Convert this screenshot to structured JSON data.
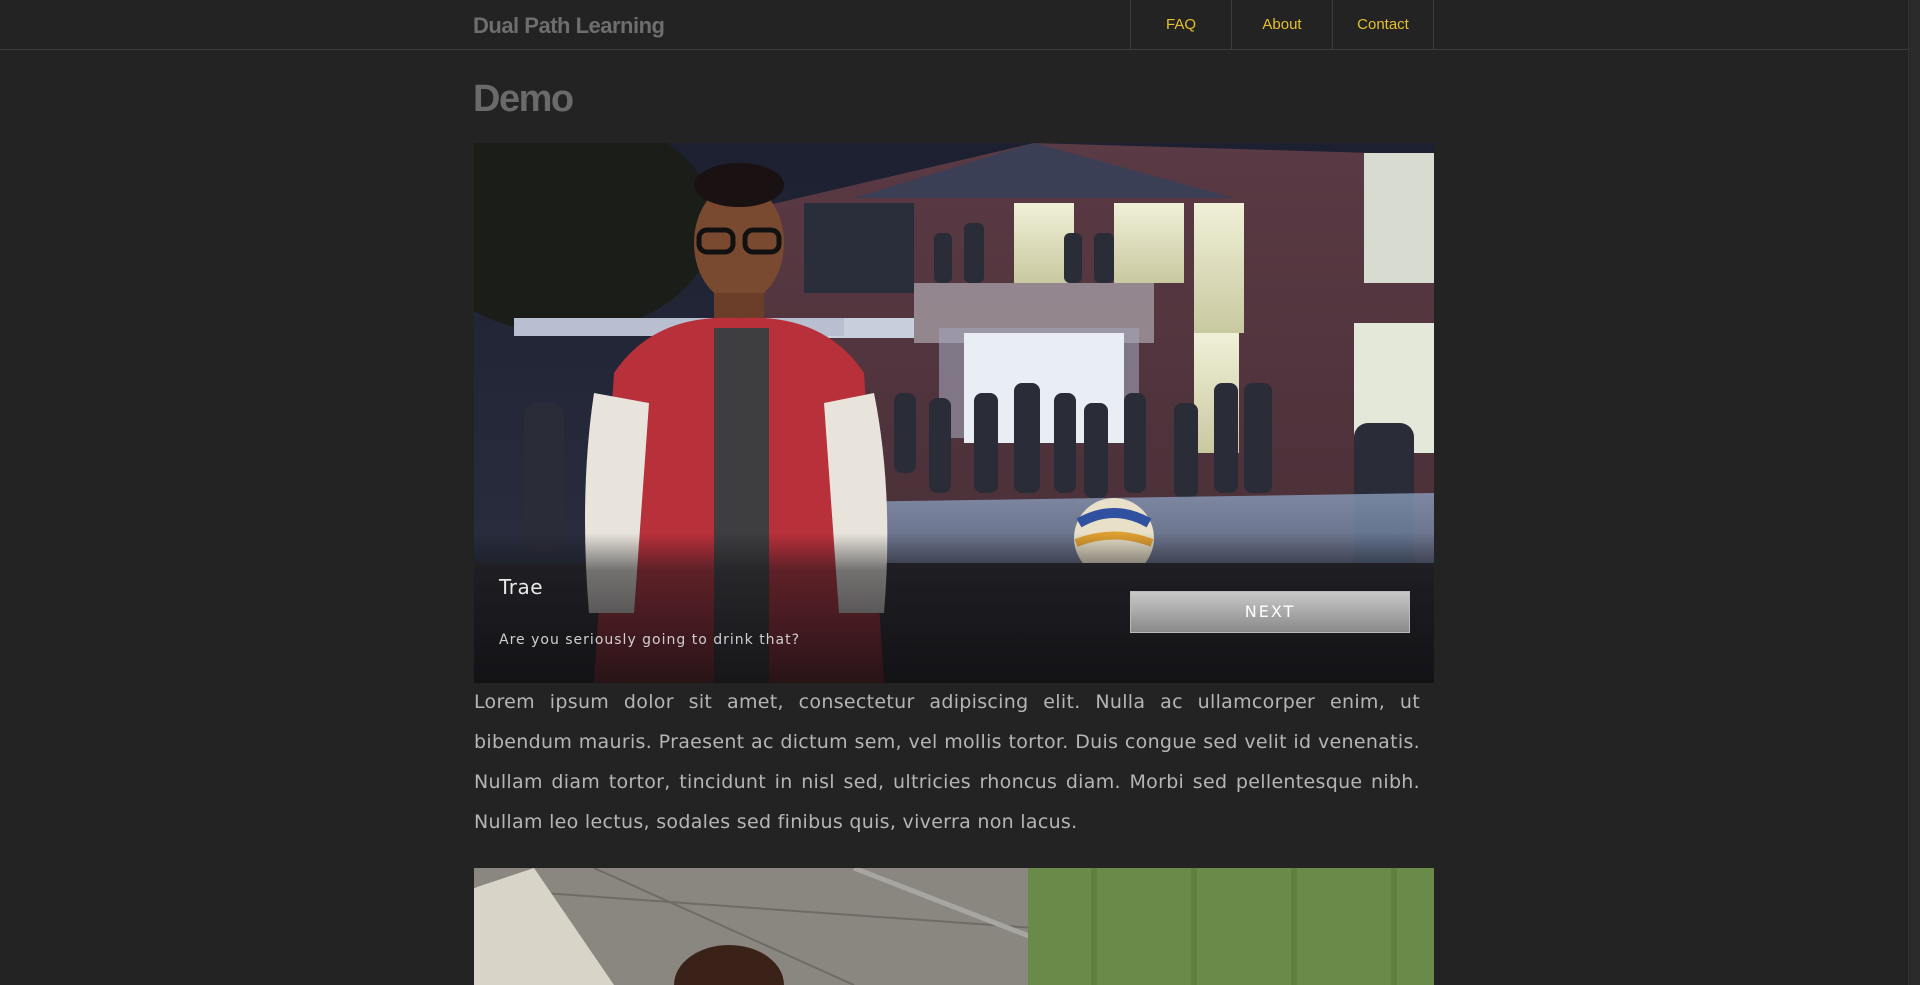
{
  "header": {
    "brand": "Dual Path Learning",
    "nav": [
      {
        "label": "FAQ"
      },
      {
        "label": "About"
      },
      {
        "label": "Contact"
      }
    ]
  },
  "main": {
    "title": "Demo",
    "scene": {
      "speaker": "Trae",
      "dialogue": "Are you seriously going to drink that?",
      "next_label": "NEXT"
    },
    "body_text": "Lorem ipsum dolor sit amet, consectetur adipiscing elit. Nulla ac ullamcorper enim, ut bibendum mauris. Praesent ac dictum sem, vel mollis tortor. Duis congue sed velit id venenatis. Nullam diam tortor, tincidunt in nisl sed, ultricies rhoncus diam. Morbi sed pellentesque nibh. Nullam leo lectus, sodales sed finibus quis, viverra non lacus."
  },
  "colors": {
    "background": "#232323",
    "nav_link": "#e6c030",
    "brand": "#6e6e6e"
  }
}
